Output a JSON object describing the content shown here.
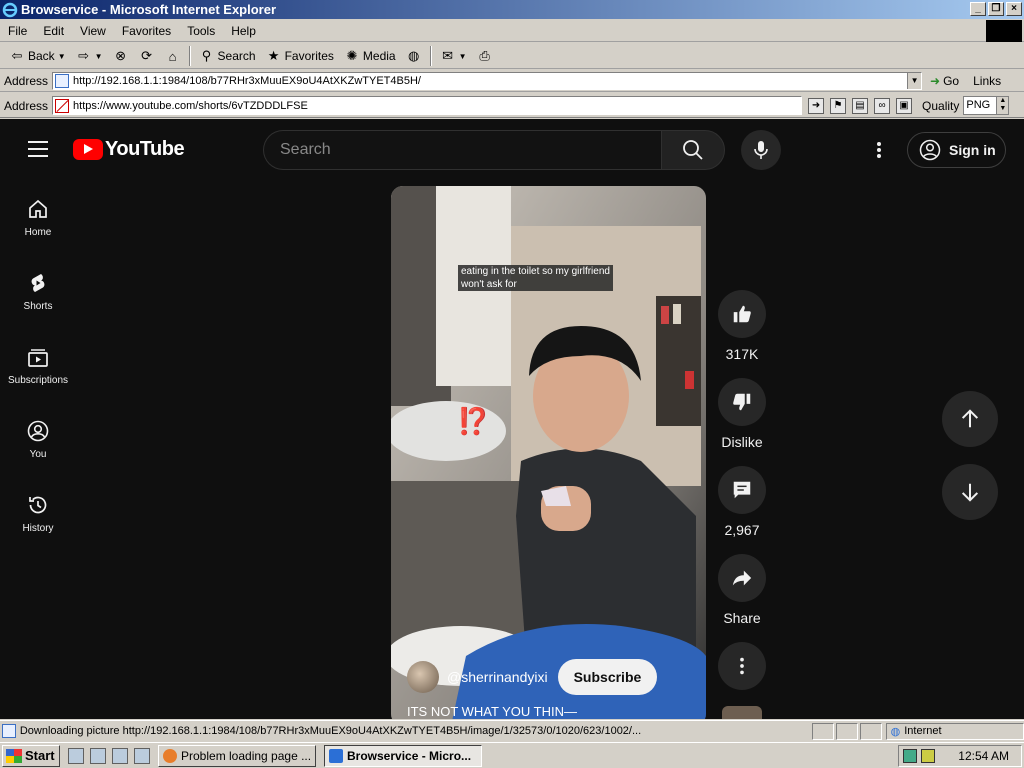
{
  "window": {
    "title": "Browservice - Microsoft Internet Explorer",
    "controls": [
      "_",
      "❐",
      "×"
    ]
  },
  "menu": [
    "File",
    "Edit",
    "View",
    "Favorites",
    "Tools",
    "Help"
  ],
  "toolbar": {
    "back": "Back",
    "search": "Search",
    "favorites": "Favorites",
    "media": "Media"
  },
  "address_bar": {
    "label": "Address",
    "url": "http://192.168.1.1:1984/108/b77RHr3xMuuEX9oU4AtXKZwTYET4B5H/",
    "go": "Go",
    "links": "Links"
  },
  "browservice_bar": {
    "label": "Address",
    "url": "https://www.youtube.com/shorts/6vTZDDDLFSE",
    "quality_label": "Quality",
    "quality_value": "PNG"
  },
  "youtube": {
    "logo_text": "YouTube",
    "search_placeholder": "Search",
    "sign_in": "Sign in",
    "sidebar": [
      {
        "label": "Home",
        "icon": "home-icon"
      },
      {
        "label": "Shorts",
        "icon": "shorts-icon"
      },
      {
        "label": "Subscriptions",
        "icon": "subscriptions-icon"
      },
      {
        "label": "You",
        "icon": "you-icon"
      },
      {
        "label": "History",
        "icon": "history-icon"
      }
    ],
    "short": {
      "caption": [
        "eating in the toilet so my girlfriend",
        "won't ask for"
      ],
      "overlay_emoji": "⁉️",
      "channel": "@sherrinandyixi",
      "subscribe": "Subscribe",
      "title": "ITS NOT WHAT YOU THIN—"
    },
    "actions": {
      "likes": "317K",
      "dislike": "Dislike",
      "comments": "2,967",
      "share": "Share"
    }
  },
  "status": {
    "text": "Downloading picture http://192.168.1.1:1984/108/b77RHr3xMuuEX9oU4AtXKZwTYET4B5H/image/1/32573/0/1020/623/1002/...",
    "zone": "Internet"
  },
  "taskbar": {
    "start": "Start",
    "tasks": [
      "Problem loading page ...",
      "Browservice - Micro..."
    ],
    "clock": "12:54 AM"
  }
}
